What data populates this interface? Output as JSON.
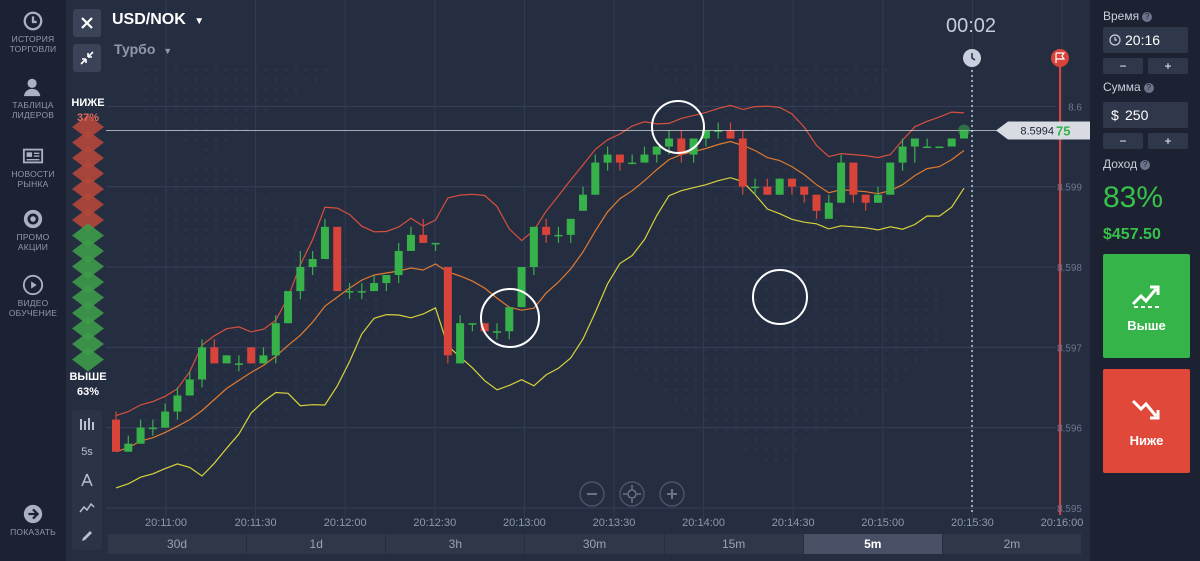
{
  "nav": {
    "items": [
      {
        "line1": "ИСТОРИЯ",
        "line2": "ТОРГОВЛИ"
      },
      {
        "line1": "ТАБЛИЦА",
        "line2": "ЛИДЕРОВ"
      },
      {
        "line1": "НОВОСТИ",
        "line2": "РЫНКА"
      },
      {
        "line1": "ПРОМО",
        "line2": "АКЦИИ"
      },
      {
        "line1": "ВИДЕО",
        "line2": "ОБУЧЕНИЕ"
      }
    ],
    "show": "ПОКАЗАТЬ"
  },
  "header": {
    "asset": "USD/NOK",
    "mode": "Турбо",
    "timer": "00:02"
  },
  "sentiment": {
    "down_label": "НИЖЕ",
    "down_pct": "37%",
    "up_label": "ВЫШЕ",
    "up_pct": "63%"
  },
  "tools": {
    "interval": "5s"
  },
  "timeframes": [
    "30d",
    "1d",
    "3h",
    "30m",
    "15m",
    "5m",
    "2m"
  ],
  "active_timeframe": "5m",
  "chart_data": {
    "type": "candlestick",
    "price_ticks": [
      "8.6",
      "8.599",
      "8.598",
      "8.597",
      "8.596",
      "8.595"
    ],
    "time_ticks": [
      "20:11:00",
      "20:11:30",
      "20:12:00",
      "20:12:30",
      "20:13:00",
      "20:13:30",
      "20:14:00",
      "20:14:30",
      "20:15:00",
      "20:15:30",
      "20:16:00"
    ],
    "current_price_main": "8.5994",
    "current_price_tail": "75",
    "ylim": [
      8.5948,
      8.6012
    ],
    "candles": [
      {
        "o": 8.5961,
        "c": 8.5957,
        "h": 8.5962,
        "l": 8.5957
      },
      {
        "o": 8.5957,
        "c": 8.5958,
        "h": 8.5959,
        "l": 8.5957
      },
      {
        "o": 8.5958,
        "c": 8.596,
        "h": 8.5961,
        "l": 8.5958
      },
      {
        "o": 8.596,
        "c": 8.596,
        "h": 8.5961,
        "l": 8.5959
      },
      {
        "o": 8.596,
        "c": 8.5962,
        "h": 8.5963,
        "l": 8.596
      },
      {
        "o": 8.5962,
        "c": 8.5964,
        "h": 8.5965,
        "l": 8.5961
      },
      {
        "o": 8.5964,
        "c": 8.5966,
        "h": 8.5967,
        "l": 8.5964
      },
      {
        "o": 8.5966,
        "c": 8.597,
        "h": 8.5971,
        "l": 8.5965
      },
      {
        "o": 8.597,
        "c": 8.5968,
        "h": 8.5971,
        "l": 8.5968
      },
      {
        "o": 8.5968,
        "c": 8.5969,
        "h": 8.5969,
        "l": 8.5968
      },
      {
        "o": 8.5968,
        "c": 8.5968,
        "h": 8.5969,
        "l": 8.5967
      },
      {
        "o": 8.597,
        "c": 8.5968,
        "h": 8.597,
        "l": 8.5968
      },
      {
        "o": 8.5968,
        "c": 8.5969,
        "h": 8.597,
        "l": 8.5968
      },
      {
        "o": 8.5969,
        "c": 8.5973,
        "h": 8.5974,
        "l": 8.5968
      },
      {
        "o": 8.5973,
        "c": 8.5977,
        "h": 8.5977,
        "l": 8.5973
      },
      {
        "o": 8.5977,
        "c": 8.598,
        "h": 8.5982,
        "l": 8.5976
      },
      {
        "o": 8.598,
        "c": 8.5981,
        "h": 8.5982,
        "l": 8.5979
      },
      {
        "o": 8.5981,
        "c": 8.5985,
        "h": 8.5986,
        "l": 8.5981
      },
      {
        "o": 8.5985,
        "c": 8.5977,
        "h": 8.5985,
        "l": 8.5977
      },
      {
        "o": 8.5977,
        "c": 8.5977,
        "h": 8.5978,
        "l": 8.5976
      },
      {
        "o": 8.5977,
        "c": 8.5977,
        "h": 8.5978,
        "l": 8.5976
      },
      {
        "o": 8.5977,
        "c": 8.5978,
        "h": 8.5979,
        "l": 8.5977
      },
      {
        "o": 8.5978,
        "c": 8.5979,
        "h": 8.5979,
        "l": 8.5977
      },
      {
        "o": 8.5979,
        "c": 8.5982,
        "h": 8.5983,
        "l": 8.5978
      },
      {
        "o": 8.5982,
        "c": 8.5984,
        "h": 8.5985,
        "l": 8.5982
      },
      {
        "o": 8.5984,
        "c": 8.5983,
        "h": 8.5986,
        "l": 8.5983
      },
      {
        "o": 8.5983,
        "c": 8.5983,
        "h": 8.5983,
        "l": 8.5982
      },
      {
        "o": 8.598,
        "c": 8.5969,
        "h": 8.598,
        "l": 8.5968
      },
      {
        "o": 8.5968,
        "c": 8.5973,
        "h": 8.5974,
        "l": 8.5968
      },
      {
        "o": 8.5973,
        "c": 8.5973,
        "h": 8.5973,
        "l": 8.5972
      },
      {
        "o": 8.5973,
        "c": 8.5972,
        "h": 8.5973,
        "l": 8.5972
      },
      {
        "o": 8.5972,
        "c": 8.5972,
        "h": 8.5973,
        "l": 8.5971
      },
      {
        "o": 8.5972,
        "c": 8.5975,
        "h": 8.5975,
        "l": 8.5971
      },
      {
        "o": 8.5975,
        "c": 8.598,
        "h": 8.598,
        "l": 8.5975
      },
      {
        "o": 8.598,
        "c": 8.5985,
        "h": 8.5985,
        "l": 8.5979
      },
      {
        "o": 8.5985,
        "c": 8.5984,
        "h": 8.5986,
        "l": 8.5983
      },
      {
        "o": 8.5984,
        "c": 8.5984,
        "h": 8.5985,
        "l": 8.5983
      },
      {
        "o": 8.5984,
        "c": 8.5986,
        "h": 8.5986,
        "l": 8.5983
      },
      {
        "o": 8.5987,
        "c": 8.5989,
        "h": 8.599,
        "l": 8.5987
      },
      {
        "o": 8.5989,
        "c": 8.5993,
        "h": 8.5994,
        "l": 8.5989
      },
      {
        "o": 8.5993,
        "c": 8.5994,
        "h": 8.5995,
        "l": 8.5992
      },
      {
        "o": 8.5994,
        "c": 8.5993,
        "h": 8.5994,
        "l": 8.5992
      },
      {
        "o": 8.5993,
        "c": 8.5993,
        "h": 8.5994,
        "l": 8.5993
      },
      {
        "o": 8.5993,
        "c": 8.5994,
        "h": 8.5995,
        "l": 8.5993
      },
      {
        "o": 8.5994,
        "c": 8.5995,
        "h": 8.5995,
        "l": 8.5993
      },
      {
        "o": 8.5995,
        "c": 8.5996,
        "h": 8.5997,
        "l": 8.5994
      },
      {
        "o": 8.5996,
        "c": 8.5994,
        "h": 8.5997,
        "l": 8.5993
      },
      {
        "o": 8.5994,
        "c": 8.5996,
        "h": 8.5996,
        "l": 8.5993
      },
      {
        "o": 8.5996,
        "c": 8.5997,
        "h": 8.5997,
        "l": 8.5995
      },
      {
        "o": 8.5997,
        "c": 8.5997,
        "h": 8.5998,
        "l": 8.5996
      },
      {
        "o": 8.5997,
        "c": 8.5996,
        "h": 8.5998,
        "l": 8.5996
      },
      {
        "o": 8.5996,
        "c": 8.599,
        "h": 8.5997,
        "l": 8.5989
      },
      {
        "o": 8.599,
        "c": 8.599,
        "h": 8.5991,
        "l": 8.5989
      },
      {
        "o": 8.599,
        "c": 8.5989,
        "h": 8.5991,
        "l": 8.5989
      },
      {
        "o": 8.5989,
        "c": 8.5991,
        "h": 8.5991,
        "l": 8.5989
      },
      {
        "o": 8.5991,
        "c": 8.599,
        "h": 8.5991,
        "l": 8.5989
      },
      {
        "o": 8.599,
        "c": 8.5989,
        "h": 8.599,
        "l": 8.5988
      },
      {
        "o": 8.5989,
        "c": 8.5987,
        "h": 8.5989,
        "l": 8.5986
      },
      {
        "o": 8.5986,
        "c": 8.5988,
        "h": 8.5989,
        "l": 8.5986
      },
      {
        "o": 8.5988,
        "c": 8.5993,
        "h": 8.5994,
        "l": 8.5988
      },
      {
        "o": 8.5993,
        "c": 8.5989,
        "h": 8.5993,
        "l": 8.5988
      },
      {
        "o": 8.5989,
        "c": 8.5988,
        "h": 8.5989,
        "l": 8.5987
      },
      {
        "o": 8.5988,
        "c": 8.5989,
        "h": 8.599,
        "l": 8.5988
      },
      {
        "o": 8.5989,
        "c": 8.5993,
        "h": 8.5993,
        "l": 8.5989
      },
      {
        "o": 8.5993,
        "c": 8.5995,
        "h": 8.5996,
        "l": 8.5992
      },
      {
        "o": 8.5995,
        "c": 8.5996,
        "h": 8.5996,
        "l": 8.5993
      },
      {
        "o": 8.5995,
        "c": 8.5995,
        "h": 8.5996,
        "l": 8.5995
      },
      {
        "o": 8.5995,
        "c": 8.5995,
        "h": 8.5995,
        "l": 8.5995
      },
      {
        "o": 8.5995,
        "c": 8.5996,
        "h": 8.5996,
        "l": 8.5995
      },
      {
        "o": 8.5996,
        "c": 8.5997,
        "h": 8.5997,
        "l": 8.5996
      }
    ],
    "colors": {
      "up": "#37b24a",
      "down": "#d9443a",
      "upper_band": "#d6503d",
      "mid_band": "#e07b2e",
      "lower_band": "#d8d23a"
    }
  },
  "panel": {
    "time_label": "Время",
    "time_value": "20:16",
    "amount_label": "Сумма",
    "currency": "$",
    "amount_value": "250",
    "minus": "−",
    "plus": "+",
    "income_label": "Доход",
    "payout_pct": "83%",
    "payout_amt": "$457.50",
    "up_label": "Выше",
    "down_label": "Ниже",
    "colors": {
      "up": "#35b44a",
      "down": "#e0493a"
    }
  }
}
